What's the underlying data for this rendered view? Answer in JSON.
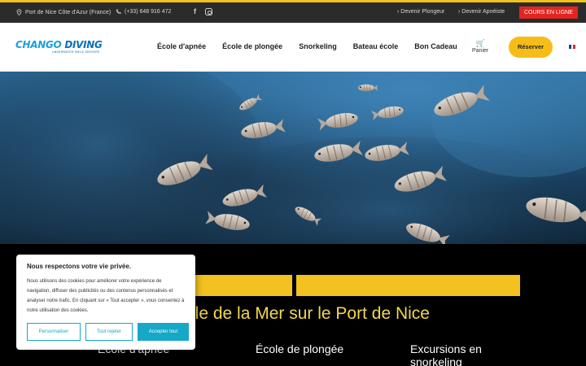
{
  "topbar": {
    "location": "Port de Nice Côte d'Azur (France)",
    "phone": "(+33) 648 916 472",
    "facebook_icon": "f",
    "link_plongeur": "› Devenir Plongeur",
    "link_apneiste": "› Devenir Apnéiste",
    "cours_button": "COURS EN LIGNE",
    "accent_color": "#f2c21b",
    "cours_color": "#e32420"
  },
  "header": {
    "logo_part1": "CHANGO ",
    "logo_part2": "DIVING",
    "logo_tagline": "UNDERWATER SMILE SEEKERS",
    "nav": [
      "École d'apnée",
      "École de plongée",
      "Snorkeling",
      "Bateau école",
      "Bon Cadeau"
    ],
    "cart_icon": "🛒",
    "cart_label": "Panier",
    "reserve_button": "Réserver",
    "button_color": "#f6bd16"
  },
  "hero": {
    "image_description": "school of striped sea bream over a rocky reef"
  },
  "section": {
    "tagline": "ole de la Mer sur le Port de Nice",
    "columns": [
      "École d'apnée",
      "École de plongée",
      "Excursions en snorkeling"
    ]
  },
  "cookie": {
    "title": "Nous respectons votre vie privée.",
    "body": "Nous utilisons des cookies pour améliorer votre expérience de navigation, diffuser des publicités ou des contenus personnalisés et analyser notre trafic. En cliquant sur « Tout accepter », vous consentez à notre utilisation des cookies.",
    "customize": "Personnaliser",
    "reject": "Tout rejeter",
    "accept": "Accepter tout",
    "button_color": "#17a7c7"
  }
}
